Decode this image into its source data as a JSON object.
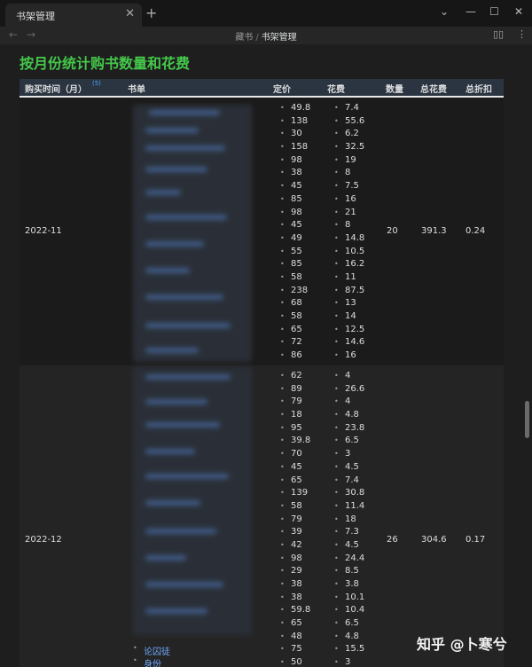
{
  "tab": {
    "title": "书架管理",
    "close": "✕",
    "new": "+"
  },
  "window": {
    "dropdown": "⌄",
    "minimize": "—",
    "maximize": "☐",
    "close": "✕"
  },
  "nav": {
    "back": "←",
    "forward": "→",
    "crumb1": "藏书",
    "sep": "/",
    "crumb2": "书架管理",
    "book_icon": "▯▯",
    "more_icon": "⋮"
  },
  "page": {
    "title": "按月份统计购书数量和花费"
  },
  "table": {
    "headers": {
      "time": "购买时间（月）",
      "time_count": "(5)",
      "books": "书单",
      "price": "定价",
      "cost": "花费",
      "qty": "数量",
      "total": "总花费",
      "discount": "总折扣"
    },
    "rows": [
      {
        "month": "2022-11",
        "prices": [
          "49.8",
          "138",
          "30",
          "158",
          "98",
          "38",
          "45",
          "85",
          "98",
          "45",
          "49",
          "55",
          "85",
          "58",
          "238",
          "68",
          "58",
          "65",
          "72",
          "86"
        ],
        "costs": [
          "7.4",
          "55.6",
          "6.2",
          "32.5",
          "19",
          "8",
          "7.5",
          "16",
          "21",
          "8",
          "14.8",
          "10.5",
          "16.2",
          "11",
          "87.5",
          "13",
          "14",
          "12.5",
          "14.6",
          "16"
        ],
        "qty": "20",
        "total": "391.3",
        "discount": "0.24"
      },
      {
        "month": "2022-12",
        "prices": [
          "62",
          "89",
          "79",
          "18",
          "95",
          "39.8",
          "70",
          "45",
          "65",
          "139",
          "58",
          "79",
          "39",
          "42",
          "98",
          "29",
          "38",
          "38",
          "59.8",
          "65",
          "48",
          "75",
          "50"
        ],
        "costs": [
          "4",
          "26.6",
          "4",
          "4.8",
          "23.8",
          "6.5",
          "3",
          "4.5",
          "7.4",
          "30.8",
          "11.4",
          "18",
          "7.3",
          "4.5",
          "24.4",
          "8.5",
          "3.8",
          "10.1",
          "10.4",
          "6.5",
          "4.8",
          "15.5",
          "3"
        ],
        "qty": "26",
        "total": "304.6",
        "discount": "0.17",
        "visible_books": [
          "论囚徒",
          "身份"
        ]
      }
    ]
  },
  "watermark": "知乎 @卜寒兮",
  "colors": {
    "title_green": "#44c84a",
    "link_blue": "#6fa8ff",
    "header_bg": "#2b3541"
  }
}
